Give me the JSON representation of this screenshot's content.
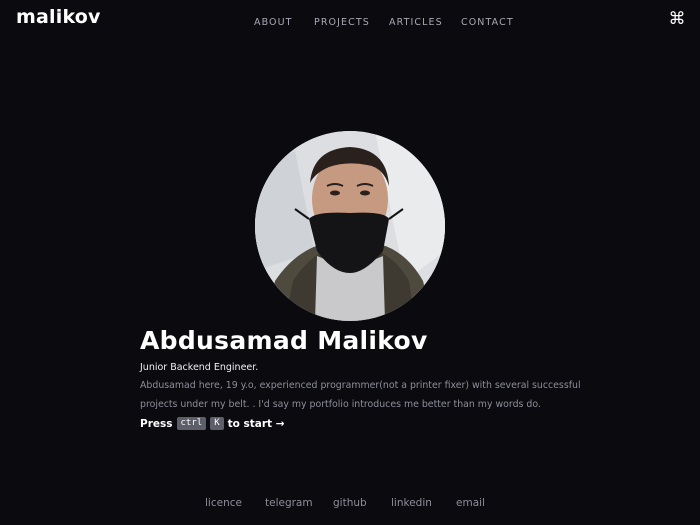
{
  "brand": {
    "logo_text": "malikov"
  },
  "nav": {
    "items": [
      {
        "label": "ABOUT"
      },
      {
        "label": "PROJECTS"
      },
      {
        "label": "ARTICLES"
      },
      {
        "label": "CONTACT"
      }
    ],
    "command_icon": "command-icon",
    "command_glyph": "⌘"
  },
  "hero": {
    "name": "Abdusamad Malikov",
    "role": "Junior Backend Engineer.",
    "bio": "Abdusamad here, 19 y.o, experienced programmer(not a printer fixer) with several successful projects under my belt. . I'd say my portfolio introduces me better than my words do.",
    "press_label": "Press",
    "key_ctrl": "ctrl",
    "key_k": "K",
    "start_label": "to start →"
  },
  "footer": {
    "links": [
      {
        "label": "licence"
      },
      {
        "label": "telegram"
      },
      {
        "label": "github"
      },
      {
        "label": "linkedin"
      },
      {
        "label": "email"
      }
    ]
  },
  "colors": {
    "background": "#0b0a0f",
    "text_primary": "#ffffff",
    "text_muted": "#8e8e9a",
    "kbd_bg": "#5c5f69"
  }
}
